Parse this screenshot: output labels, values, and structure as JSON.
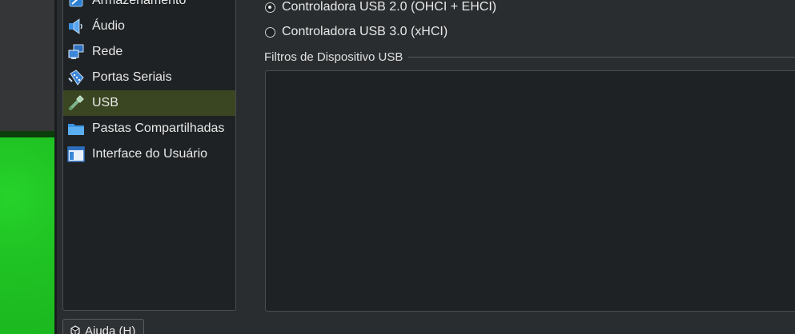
{
  "sidebar": {
    "items": [
      {
        "label": "Armazenamento",
        "icon": "storage-icon"
      },
      {
        "label": "Áudio",
        "icon": "audio-icon"
      },
      {
        "label": "Rede",
        "icon": "network-icon"
      },
      {
        "label": "Portas Seriais",
        "icon": "serial-ports-icon"
      },
      {
        "label": "USB",
        "icon": "usb-icon",
        "selected": true
      },
      {
        "label": "Pastas Compartilhadas",
        "icon": "shared-folders-icon"
      },
      {
        "label": "Interface do Usuário",
        "icon": "user-interface-icon"
      }
    ]
  },
  "usb": {
    "options": [
      {
        "label": "Controladora USB 2.0 (OHCI + EHCI)",
        "checked": true
      },
      {
        "label": "Controladora USB 3.0 (xHCI)",
        "checked": false
      }
    ],
    "filters_title": "Filtros de Dispositivo USB"
  },
  "footer": {
    "help_label": "Ajuda (H)"
  },
  "colors": {
    "selected_bg": "#3a4521",
    "list_bg": "#1f2224",
    "desktop_green": "#20c424"
  }
}
